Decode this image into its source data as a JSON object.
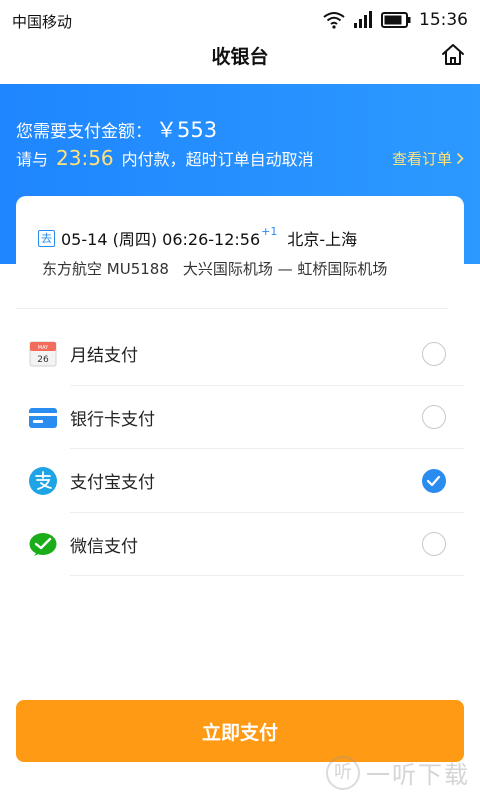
{
  "status_bar": {
    "carrier": "中国移动",
    "time": "15:36"
  },
  "header": {
    "title": "收银台"
  },
  "banner": {
    "amount_label": "您需要支付金额：",
    "amount": "￥553",
    "deadline_prefix": "请与",
    "deadline_time": "23:56",
    "deadline_suffix": "内付款，超时订单自动取消",
    "view_order": "查看订单"
  },
  "flight": {
    "direction_tag": "去",
    "date_time": "05-14 (周四) 06:26-12:56",
    "plus_day": "+1",
    "route": "北京-上海",
    "airline": "东方航空 MU5188",
    "airports": "大兴国际机场 — 虹桥国际机场"
  },
  "payment_methods": [
    {
      "label": "月结支付",
      "icon": "calendar-icon",
      "selected": false
    },
    {
      "label": "银行卡支付",
      "icon": "bank-card-icon",
      "selected": false
    },
    {
      "label": "支付宝支付",
      "icon": "alipay-icon",
      "selected": true
    },
    {
      "label": "微信支付",
      "icon": "wechat-icon",
      "selected": false
    }
  ],
  "calendar_icon_text": {
    "month": "MAY",
    "day": "26"
  },
  "pay_button": "立即支付",
  "watermark": {
    "logo": "听",
    "text": "一听下载"
  },
  "colors": {
    "primary": "#2b8cf0",
    "accent": "#ff9a14",
    "highlight": "#ffe27a"
  }
}
